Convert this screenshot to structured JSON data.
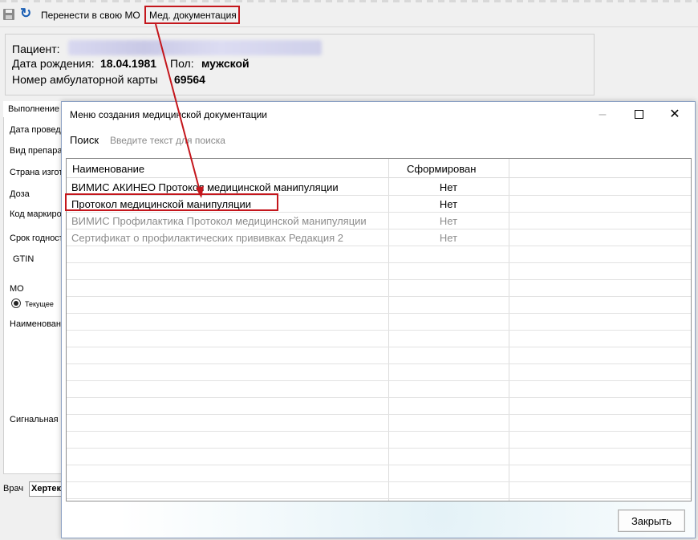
{
  "toolbar": {
    "transfer_label": "Перенести в свою МО",
    "med_doc_label": "Мед. документация"
  },
  "patient": {
    "name_label": "Пациент:",
    "dob_label": "Дата рождения:",
    "dob_value": "18.04.1981",
    "sex_label": "Пол:",
    "sex_value": "мужской",
    "card_label": "Номер амбулаторной карты",
    "card_value": "69564"
  },
  "form": {
    "tab_label": "Выполнение",
    "fields": [
      "Дата провед",
      "Вид препара",
      "Страна изгот",
      "Доза",
      "Код маркиро",
      "Срок годност",
      "GTIN",
      "МО",
      "Текущее",
      "Наименован",
      "Сигнальная и"
    ],
    "doctor_label": "Врач",
    "doctor_value": "Хертек"
  },
  "dialog": {
    "title": "Меню создания медицинской документации",
    "search_label": "Поиск",
    "search_placeholder": "Введите текст для поиска",
    "columns": [
      "Наименование",
      "Сформирован"
    ],
    "rows": [
      {
        "name": "ВИМИС АКИНЕО Протокол медицинской манипуляции",
        "status": "Нет",
        "enabled": true
      },
      {
        "name": "Протокол медицинской манипуляции",
        "status": "Нет",
        "enabled": true
      },
      {
        "name": "ВИМИС Профилактика Протокол медицинской манипуляции",
        "status": "Нет",
        "enabled": false
      },
      {
        "name": "Сертификат о профилактических прививках Редакция 2",
        "status": "Нет",
        "enabled": false
      }
    ],
    "close_label": "Закрыть"
  },
  "colors": {
    "highlight": "#c4161c",
    "disabled_text": "#8c8c8c"
  },
  "icons": [
    "save-icon",
    "refresh-icon",
    "minimize-icon",
    "maximize-icon",
    "close-icon"
  ]
}
